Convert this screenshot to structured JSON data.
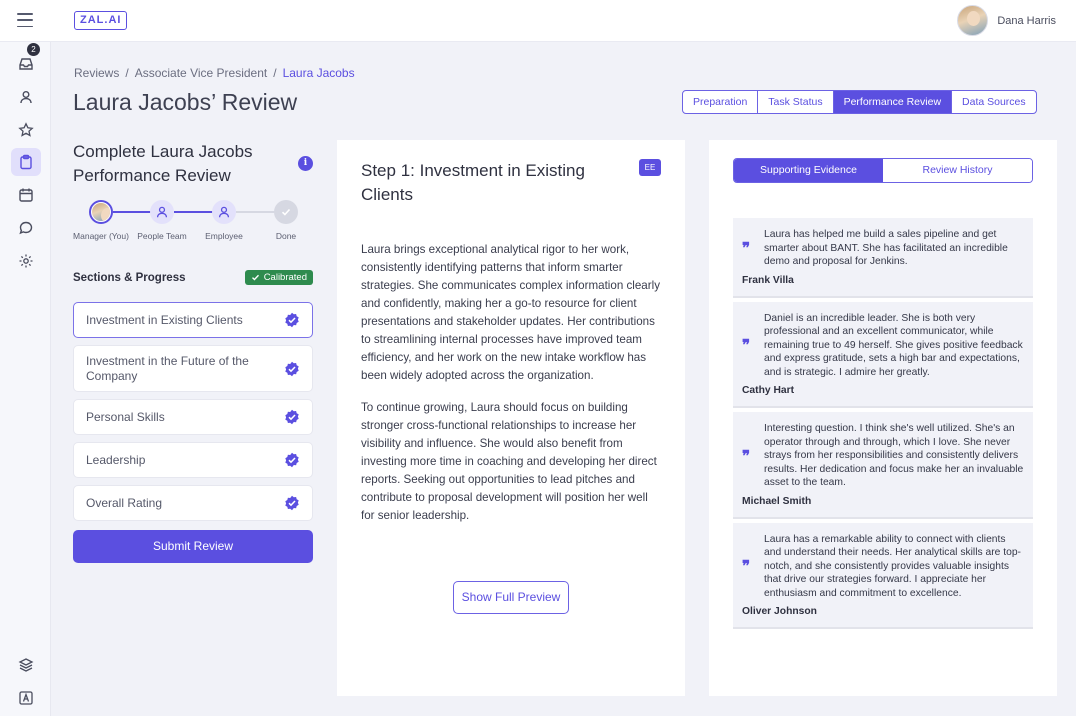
{
  "app": {
    "logo": "ZAL.AI",
    "user_name": "Dana Harris",
    "inbox_count": "2"
  },
  "breadcrumb": {
    "items": [
      "Reviews",
      "Associate Vice President",
      "Laura Jacobs"
    ],
    "separator": "/"
  },
  "page_title": "Laura Jacobs’ Review",
  "tabs": [
    {
      "label": "Preparation",
      "active": false
    },
    {
      "label": "Task Status",
      "active": false
    },
    {
      "label": "Performance Review",
      "active": true
    },
    {
      "label": "Data Sources",
      "active": false
    }
  ],
  "left_panel": {
    "title": "Complete Laura Jacobs Performance Review",
    "info_icon": "i",
    "steps": [
      {
        "label": "Manager (You)",
        "state": "done"
      },
      {
        "label": "People Team",
        "state": "done"
      },
      {
        "label": "Employee",
        "state": "done"
      },
      {
        "label": "Done",
        "state": "pending"
      }
    ],
    "sections_title": "Sections & Progress",
    "calibrated_label": "Calibrated",
    "sections": [
      {
        "label": "Investment in Existing Clients",
        "active": true,
        "complete": true
      },
      {
        "label": "Investment in the Future of the Company",
        "active": false,
        "complete": true
      },
      {
        "label": "Personal Skills",
        "active": false,
        "complete": true
      },
      {
        "label": "Leadership",
        "active": false,
        "complete": true
      },
      {
        "label": "Overall Rating",
        "active": false,
        "complete": true
      }
    ],
    "submit_label": "Submit Review"
  },
  "middle_panel": {
    "title": "Step 1: Investment in Existing Clients",
    "badge": "EE",
    "paragraphs": [
      "Laura brings exceptional analytical rigor to her work, consistently identifying patterns that inform smarter strategies. She communicates complex information clearly and confidently, making her a go-to resource for client presentations and stakeholder updates. Her contributions to streamlining internal processes have improved team efficiency, and her work on the new intake workflow has been widely adopted across the organization.",
      "To continue growing, Laura should focus on building stronger cross-functional relationships to increase her visibility and influence. She would also benefit from investing more time in coaching and developing her direct reports. Seeking out opportunities to lead pitches and contribute to proposal development will position her well for senior leadership."
    ],
    "preview_button": "Show Full Preview"
  },
  "right_panel": {
    "tabs": [
      {
        "label": "Supporting Evidence",
        "active": true
      },
      {
        "label": "Review History",
        "active": false
      }
    ],
    "evidence": [
      {
        "text": "Laura has helped me build a sales pipeline and get smarter about BANT. She has facilitated an incredible demo and proposal for Jenkins.",
        "author": "Frank Villa"
      },
      {
        "text": "Daniel is an incredible leader. She is both very professional and an excellent communicator, while remaining true to 49 herself. She gives positive feedback and express gratitude, sets a high bar and expectations, and is strategic. I admire her greatly.",
        "author": "Cathy Hart"
      },
      {
        "text": "Interesting question. I think she's well utilized. She's an operator through and through, which I love. She never strays from her responsibilities and consistently delivers results. Her dedication and focus make her an invaluable asset to the team.",
        "author": "Michael Smith"
      },
      {
        "text": "Laura has a remarkable ability to connect with clients and understand their needs. Her analytical skills are top-notch, and she consistently provides valuable insights that drive our strategies forward. I appreciate her enthusiasm and commitment to excellence.",
        "author": "Oliver Johnson"
      }
    ]
  },
  "colors": {
    "accent": "#5b4fe0",
    "success": "#2e8b4e",
    "background": "#f1f2f8"
  },
  "icons": {
    "sidebar": [
      "inbox-icon",
      "user-icon",
      "star-icon",
      "clipboard-icon",
      "calendar-icon",
      "chat-icon",
      "settings-icon",
      "layers-icon",
      "font-icon"
    ]
  }
}
